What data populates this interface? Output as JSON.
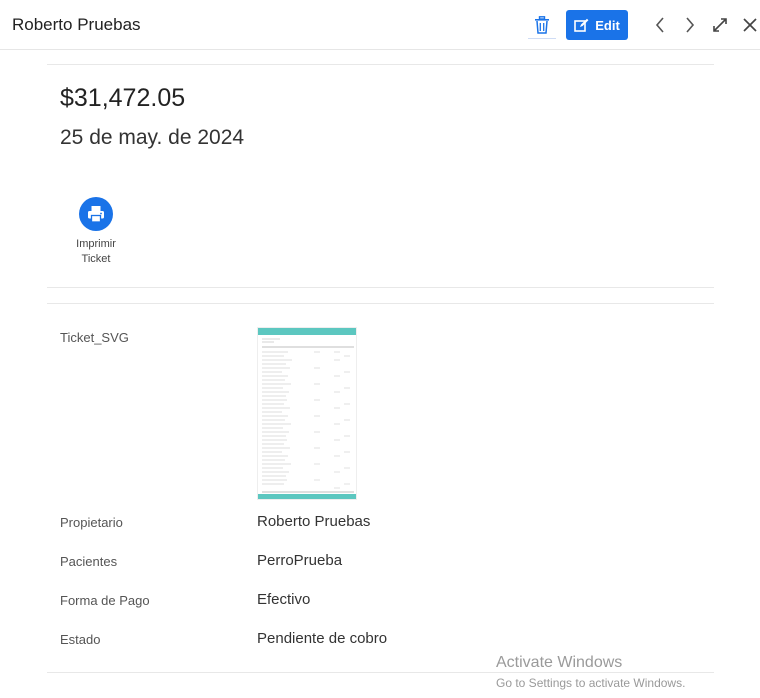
{
  "header": {
    "title": "Roberto Pruebas",
    "edit_label": "Edit"
  },
  "summary": {
    "amount": "$31,472.05",
    "date": "25 de may. de 2024"
  },
  "actions": {
    "print_label_line1": "Imprimir",
    "print_label_line2": "Ticket"
  },
  "fields": {
    "ticket_label": "Ticket_SVG",
    "owner_label": "Propietario",
    "owner_value": "Roberto Pruebas",
    "patients_label": "Pacientes",
    "patients_value": "PerroPrueba",
    "payment_label": "Forma de Pago",
    "payment_value": "Efectivo",
    "status_label": "Estado",
    "status_value": "Pendiente de cobro"
  },
  "watermark": {
    "title": "Activate Windows",
    "subtitle": "Go to Settings to activate Windows."
  },
  "colors": {
    "accent": "#1a73e8",
    "ticket_band": "#5cc7c0"
  },
  "icons": {
    "delete": "trash-icon",
    "edit": "edit-icon",
    "prev": "chevron-left-icon",
    "next": "chevron-right-icon",
    "expand": "expand-icon",
    "close": "close-icon",
    "print": "printer-icon"
  }
}
